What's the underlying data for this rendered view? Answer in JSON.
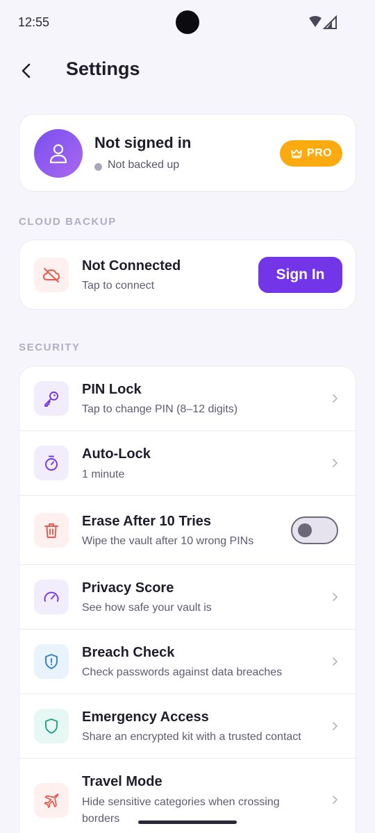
{
  "status_bar": {
    "time": "12:55"
  },
  "header": {
    "title": "Settings"
  },
  "profile": {
    "name": "Not signed in",
    "backup_status": "Not backed up",
    "badge": "PRO"
  },
  "cloud_backup": {
    "section_label": "CLOUD BACKUP",
    "title": "Not Connected",
    "subtitle": "Tap to connect",
    "button": "Sign In"
  },
  "security": {
    "section_label": "SECURITY",
    "items": [
      {
        "title": "PIN Lock",
        "subtitle": "Tap to change PIN (8–12 digits)",
        "icon": "key-icon",
        "control": "chevron"
      },
      {
        "title": "Auto-Lock",
        "subtitle": "1 minute",
        "icon": "timer-icon",
        "control": "chevron"
      },
      {
        "title": "Erase After 10 Tries",
        "subtitle": "Wipe the vault after 10 wrong PINs",
        "icon": "trash-icon",
        "control": "toggle",
        "enabled": false
      },
      {
        "title": "Privacy Score",
        "subtitle": "See how safe your vault is",
        "icon": "gauge-icon",
        "control": "chevron"
      },
      {
        "title": "Breach Check",
        "subtitle": "Check passwords against data breaches",
        "icon": "shield-alert-icon",
        "control": "chevron"
      },
      {
        "title": "Emergency Access",
        "subtitle": "Share an encrypted kit with a trusted contact",
        "icon": "shield-icon",
        "control": "chevron"
      },
      {
        "title": "Travel Mode",
        "subtitle": "Hide sensitive categories when crossing borders",
        "icon": "plane-icon",
        "control": "chevron"
      }
    ]
  },
  "colors": {
    "accent": "#7335e8",
    "pro_badge": "#fbab10",
    "danger": "#e8574b",
    "info": "#2f7fc4",
    "success": "#1fa386",
    "background": "#f6f5fb"
  }
}
